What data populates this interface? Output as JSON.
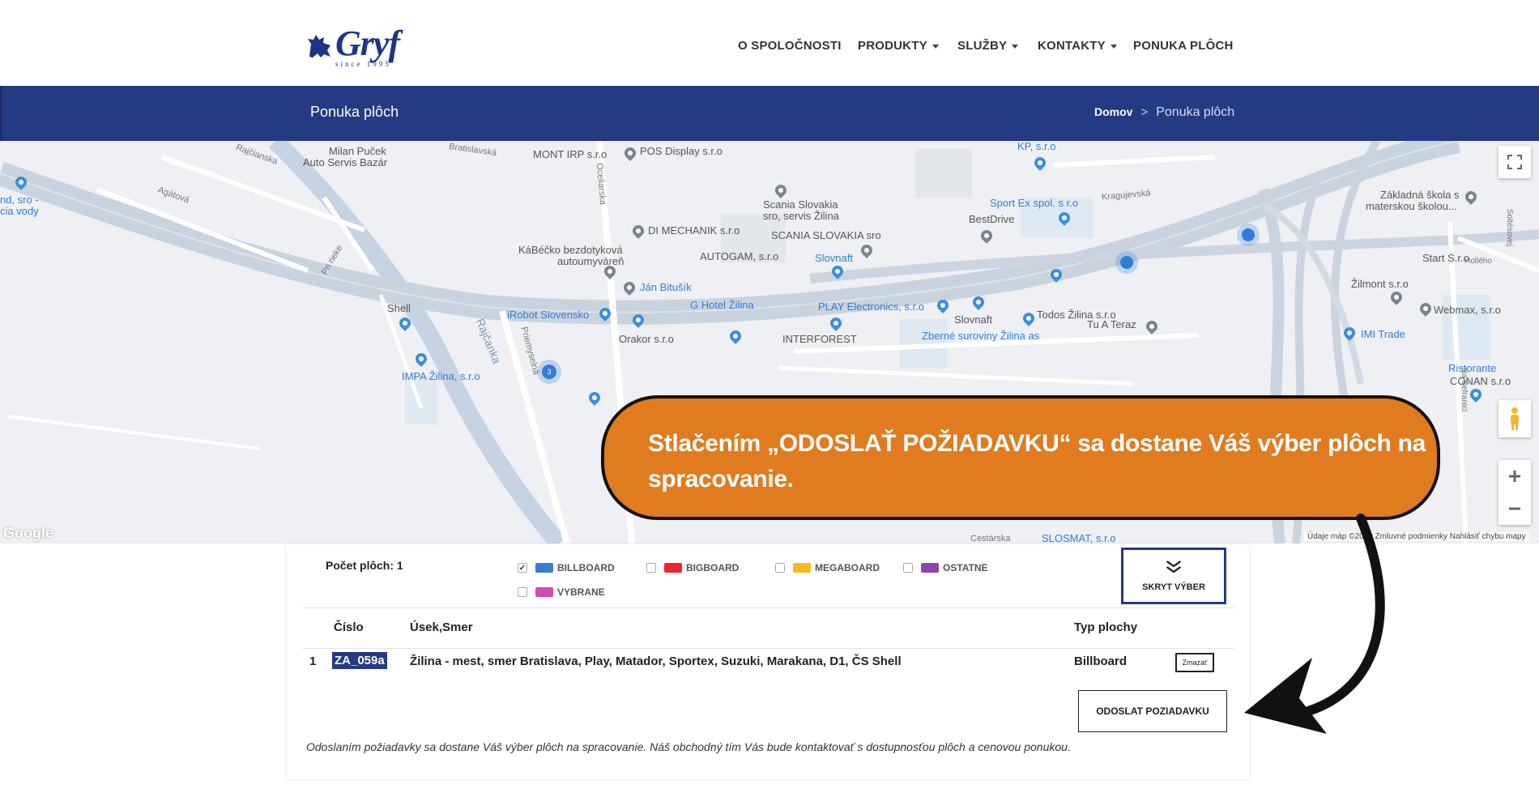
{
  "brand": {
    "name": "Gryf",
    "since": "since 1995",
    "color": "#1e3486"
  },
  "nav": [
    {
      "label": "O SPOLOČNOSTI",
      "dropdown": false
    },
    {
      "label": "PRODUKTY",
      "dropdown": true
    },
    {
      "label": "SLUŽBY",
      "dropdown": true
    },
    {
      "label": "KONTAKTY",
      "dropdown": true
    },
    {
      "label": "PONUKA PLÔCH",
      "dropdown": false
    }
  ],
  "page_bar": {
    "title": "Ponuka plôch",
    "breadcrumb_home": "Domov",
    "breadcrumb_sep": ">",
    "breadcrumb_current": "Ponuka plôch",
    "color": "#243a83"
  },
  "map": {
    "labels": {
      "milan": "Milan Puček",
      "milan2": "Auto Servis Bazár",
      "mont": "MONT IRP s.r.o",
      "pos": "POS Display s.r.o",
      "kp": "KP, s.r.o",
      "scania1": "Scania Slovakia",
      "scania2": "sro, servis Žilina",
      "sportex": "Sport Ex spol. s r.o",
      "bestdrive": "BestDrive",
      "skola1": "Základná škola s",
      "skola2": "materskou školou...",
      "dimech": "DI MECHANIK s.r.o",
      "scaniasro": "SCANIA SLOVAKIA sro",
      "kabecko1": "KáBéčko bezdotyková",
      "kabecko2": "autoumyváreň",
      "autogam": "AUTOGAM, s.r.o",
      "slovnaft1": "Slovnaft",
      "start": "Start S.r.o",
      "jan": "Ján Bitušík",
      "zilmont": "Žilmont s.r.o",
      "shell": "Shell",
      "irobot": "iRobot Slovensko",
      "ghotel": "G Hotel Žilina",
      "play": "PLAY Electronics, s.r.o",
      "webmax": "Webmax, s.r.o",
      "slovnaft2": "Slovnaft",
      "todos": "Todos Žilina s.r.o",
      "imi": "IMI Trade",
      "orakor": "Orakor s.r.o",
      "interforest": "INTERFOREST",
      "zberne": "Zberné suroviny Žilina as",
      "tuateraz": "Tu A Teraz",
      "impa": "IMPA Žilina, s.r.o",
      "ristorante": "Ristorante",
      "conan": "CONAN s.r.o",
      "nd": "nd, sro -",
      "cia": "cia vody",
      "rajcanka": "Rajčanka",
      "priemyselna": "Priemyselná",
      "rajcianska": "Rajčianska",
      "agatova": "Agátová",
      "pririeke": "Pri rieke",
      "bratislavska": "Bratislavská",
      "ocelarska": "Oceliarska",
      "kragujevska": "Kragujevská",
      "cestarska": "Cestárska",
      "slosmat": "SLOSMAT, s.r.o",
      "hollého": "Hollého",
      "solteszovej": "Soltésovej",
      "nasefranici": "Na Šefranici"
    },
    "cluster_count": "3",
    "google": "Google",
    "footer": "Údaje máp ©2019   Zmluvné podmienky   Nahlásiť chybu mapy"
  },
  "callout": {
    "text": "Stlačením „ODOSLAŤ POŽIADAVKU“ sa dostane Váš výber plôch na spracovanie.",
    "color": "#e07b20"
  },
  "selection": {
    "count_label": "Počet plôch: 1",
    "legend": [
      {
        "label": "BILLBOARD",
        "color": "#3a7bd5",
        "checked": true
      },
      {
        "label": "BIGBOARD",
        "color": "#e8262b",
        "checked": false
      },
      {
        "label": "MEGABOARD",
        "color": "#f4b822",
        "checked": false
      },
      {
        "label": "OSTATNE",
        "color": "#8e44ad",
        "checked": false
      },
      {
        "label": "VYBRANE",
        "color": "#d14bb0",
        "checked": false
      }
    ],
    "hide_button": "SKRYT VÝBER",
    "columns": {
      "num": "Číslo",
      "section": "Úsek,Smer",
      "type": "Typ plochy"
    },
    "rows": [
      {
        "index": "1",
        "code": "ZA_059a",
        "section": "Žilina - mest, smer Bratislava, Play, Matador, Sportex, Suzuki, Marakana, D1, ČS Shell",
        "type": "Billboard",
        "delete_label": "Zmazať"
      }
    ],
    "send_button": "ODOSLAT POZIADAVKU",
    "note": "Odoslaním požiadavky sa dostane Váš výber plôch na spracovanie. Náš obchodný tím Vás bude kontaktovať s dostupnosťou plôch a cenovou ponukou."
  }
}
